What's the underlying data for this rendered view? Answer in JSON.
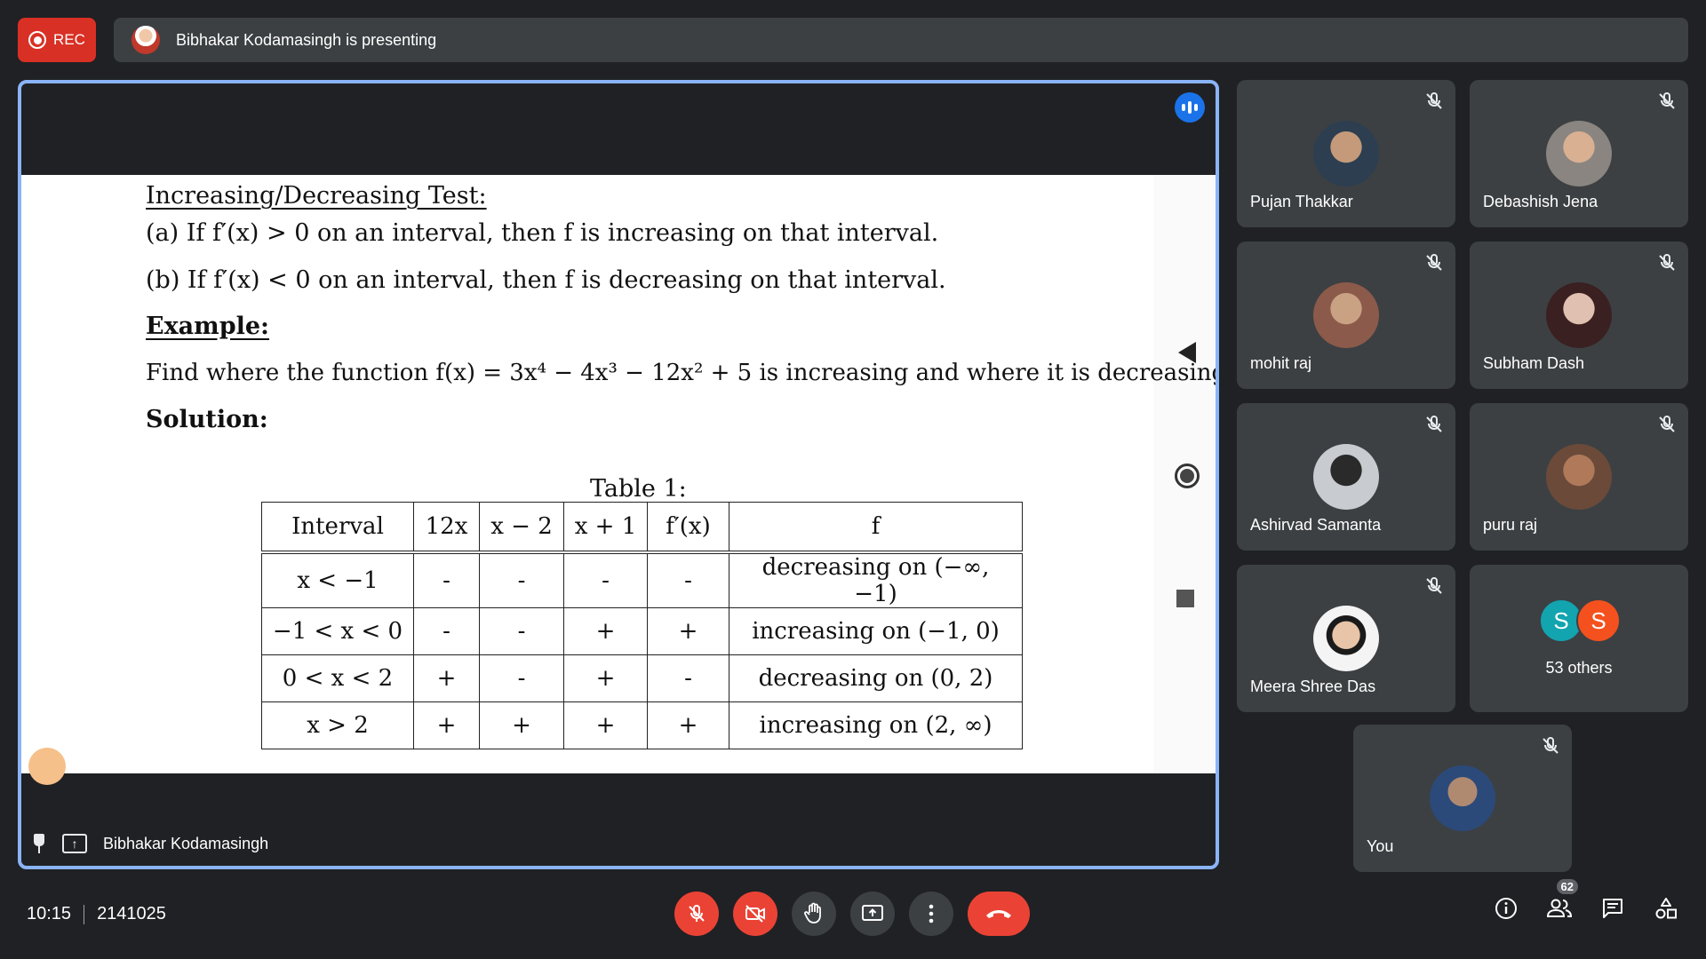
{
  "header": {
    "rec_label": "REC",
    "presenting_text": "Bibhakar Kodamasingh is presenting"
  },
  "slide": {
    "heading": "Increasing/Decreasing Test:",
    "line_a": "(a) If f′(x) > 0 on an interval, then f is increasing on that interval.",
    "line_b": "(b) If f′(x) < 0 on an interval, then f is decreasing on that interval.",
    "example_heading": "Example:",
    "example_text": "Find where the function f(x) = 3x⁴ − 4x³ − 12x² + 5 is increasing and where it is decreasing",
    "solution_heading": "Solution:",
    "table_caption": "Table 1:",
    "table_headers": [
      "Interval",
      "12x",
      "x − 2",
      "x + 1",
      "f′(x)",
      "f"
    ],
    "table_rows": [
      [
        "x < −1",
        "-",
        "-",
        "-",
        "-",
        "decreasing on (−∞, −1)"
      ],
      [
        "−1 < x < 0",
        "-",
        "-",
        "+",
        "+",
        "increasing on (−1, 0)"
      ],
      [
        "0 < x < 2",
        "+",
        "-",
        "+",
        "-",
        "decreasing on (0, 2)"
      ],
      [
        "x > 2",
        "+",
        "+",
        "+",
        "+",
        "increasing on (2, ∞)"
      ]
    ]
  },
  "stage_footer": {
    "presenter_name": "Bibhakar Kodamasingh"
  },
  "participants": [
    {
      "name": "Pujan Thakkar",
      "muted": true
    },
    {
      "name": "Debashish Jena",
      "muted": true
    },
    {
      "name": "mohit raj",
      "muted": true
    },
    {
      "name": "Subham Dash",
      "muted": true
    },
    {
      "name": "Ashirvad Samanta",
      "muted": true
    },
    {
      "name": "puru raj",
      "muted": true
    },
    {
      "name": "Meera Shree Das",
      "muted": true
    }
  ],
  "others": {
    "initials": [
      "S",
      "S"
    ],
    "colors": [
      "#12a4af",
      "#f4511e"
    ],
    "label": "53 others"
  },
  "self_tile": {
    "name": "You",
    "muted": true
  },
  "bottom": {
    "time": "10:15",
    "meeting_code": "2141025",
    "participant_count": "62"
  },
  "colors": {
    "rec": "#d93025",
    "active_border": "#8ab4f8",
    "speaking": "#1a73e8",
    "danger": "#ea4335",
    "tile_bg": "#3c4043"
  }
}
